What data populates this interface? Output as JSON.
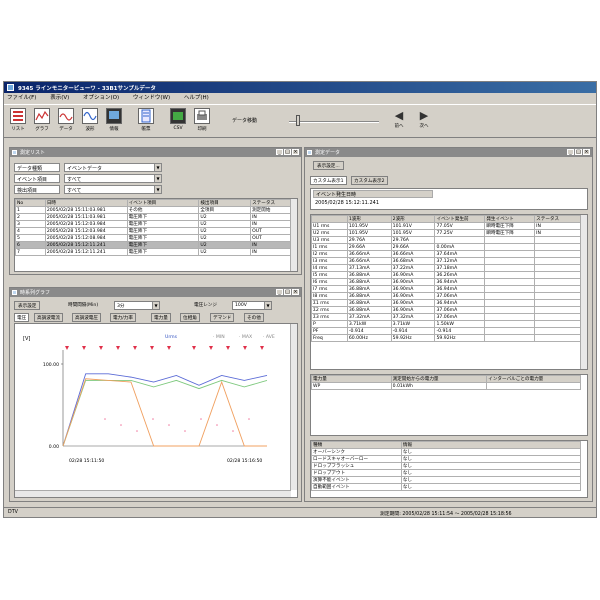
{
  "window": {
    "title": "9345 ラインモニタービューワ - 33B1サンプルデータ"
  },
  "menu": [
    "ファイル(F)",
    "表示(V)",
    "オプション(O)",
    "ウィンドウ(W)",
    "ヘルプ(H)"
  ],
  "toolbar": {
    "buttons": [
      "リスト",
      "グラフ",
      "データ",
      "波形",
      "情報",
      "帳票",
      "CSV",
      "印刷"
    ],
    "slider_label": "データ移動",
    "prev_label": "前へ",
    "next_label": "次へ"
  },
  "event_panel": {
    "title": "測定リスト",
    "filters": [
      {
        "label": "データ種類",
        "value": "イベントデータ"
      },
      {
        "label": "イベント項目",
        "value": "すべて"
      },
      {
        "label": "検出項目",
        "value": "すべて"
      }
    ],
    "columns": [
      "No",
      "日時",
      "イベント項目",
      "検出項目",
      "ステータス"
    ],
    "rows": [
      [
        "1",
        "2005/02/28 15:11:03.981",
        "その他",
        "全項目",
        "測定開始"
      ],
      [
        "2",
        "2005/02/28 15:11:03.981",
        "電圧降下",
        "U2",
        "IN"
      ],
      [
        "3",
        "2005/02/28 15:12:03.984",
        "電圧降下",
        "U2",
        "IN"
      ],
      [
        "4",
        "2005/02/28 15:12:03.984",
        "電圧降下",
        "U2",
        "OUT"
      ],
      [
        "5",
        "2005/02/28 15:12:08.984",
        "電圧降下",
        "U2",
        "OUT"
      ],
      [
        "6",
        "2005/02/28 15:12:11.241",
        "電圧降下",
        "U2",
        "IN"
      ],
      [
        "7",
        "2005/02/28 15:12:11.241",
        "電圧降下",
        "U2",
        "IN"
      ]
    ],
    "selected_row": 5
  },
  "graph_panel": {
    "title": "時系列グラフ",
    "display_settings": "表示設定",
    "interval_label": "時間間隔(Min)",
    "interval_value": "3分",
    "range_label": "電圧レンジ",
    "range_value": "100V",
    "tabs": [
      "電圧",
      "高調波電流",
      "高調波電圧",
      "電力/力率",
      "電力量",
      "位相角",
      "デマンド",
      "その他"
    ],
    "active_tab": 0,
    "legend": [
      "Urms",
      "MIN",
      "MAX",
      "AVE"
    ],
    "unit": "[V]",
    "x_labels": [
      "02/28 15:11:50",
      "02/28 15:16:50"
    ],
    "colors": {
      "blue": "#5b6bd6",
      "green": "#7fc97f",
      "orange": "#f0a060",
      "pink": "#f07aa0",
      "marker": "#e0304a"
    }
  },
  "chart_data": {
    "type": "line",
    "ylabel": "[V]",
    "ylim": [
      0,
      100
    ],
    "y_ticks": [
      "100.00",
      "0.00"
    ],
    "x": [
      0,
      1,
      2,
      3,
      4,
      5,
      6,
      7,
      8,
      9
    ],
    "series": [
      {
        "name": "MAX",
        "color": "#5b6bd6",
        "values": [
          0,
          88,
          88,
          84,
          78,
          86,
          74,
          86,
          80,
          86
        ]
      },
      {
        "name": "AVE",
        "color": "#7fc97f",
        "values": [
          0,
          80,
          80,
          80,
          72,
          80,
          70,
          80,
          72,
          80
        ]
      },
      {
        "name": "MIN",
        "color": "#f0a060",
        "values": [
          0,
          82,
          80,
          78,
          0,
          0,
          0,
          78,
          0,
          0
        ]
      }
    ],
    "grid": false,
    "legend": "top-right"
  },
  "measure_panel": {
    "title": "測定データ",
    "display_settings": "表示設定...",
    "tabs": [
      "カスタム表示1",
      "カスタム表示2"
    ],
    "event_time_label": "イベント発生日時",
    "event_time": "2005/02/28 15:12:11.241",
    "columns": [
      "",
      "1波形",
      "2波形",
      "イベント発生前",
      "発生イベント",
      "ステータス"
    ],
    "rows": [
      [
        "U1 rms",
        "101.95V",
        "101.91V",
        "77.05V",
        "瞬時電圧下降",
        "IN"
      ],
      [
        "U2 rms",
        "101.95V",
        "101.95V",
        "77.25V",
        "瞬時電圧下降",
        "IN"
      ],
      [
        "U3 rms",
        "29.76A",
        "29.76A",
        "",
        "",
        ""
      ],
      [
        "I1 rms",
        "29.66A",
        "29.66A",
        "0.00mA",
        "",
        ""
      ],
      [
        "I2 rms",
        "36.66mA",
        "36.66mA",
        "37.64mA",
        "",
        ""
      ],
      [
        "I3 rms",
        "36.66mA",
        "36.68mA",
        "37.12mA",
        "",
        ""
      ],
      [
        "I4 rms",
        "37.13mA",
        "37.22mA",
        "37.18mA",
        "",
        ""
      ],
      [
        "I5 rms",
        "36.88mA",
        "36.90mA",
        "36.26mA",
        "",
        ""
      ],
      [
        "I6 rms",
        "36.88mA",
        "36.90mA",
        "36.94mA",
        "",
        ""
      ],
      [
        "I7 rms",
        "36.88mA",
        "36.90mA",
        "36.94mA",
        "",
        ""
      ],
      [
        "I8 rms",
        "36.88mA",
        "36.90mA",
        "37.06mA",
        "",
        ""
      ],
      [
        "Σ1 rms",
        "36.88mA",
        "36.90mA",
        "36.94mA",
        "",
        ""
      ],
      [
        "Σ2 rms",
        "36.88mA",
        "36.90mA",
        "37.06mA",
        "",
        ""
      ],
      [
        "Σ3 rms",
        "37.32mA",
        "37.32mA",
        "37.06mA",
        "",
        ""
      ],
      [
        "P",
        "3.71kW",
        "3.71kW",
        "1.50kW",
        "",
        ""
      ],
      [
        "PF",
        "-0.914",
        "-0.914",
        "-0.914",
        "",
        ""
      ],
      [
        "Freq",
        "60.00Hz",
        "59.92Hz",
        "59.92Hz",
        "",
        ""
      ]
    ],
    "power_columns": [
      "電力量",
      "測定開始からの電力量",
      "インターバルごとの電力量"
    ],
    "power_rows": [
      [
        "WP",
        "0.01kWh",
        ""
      ]
    ],
    "info_columns": [
      "種類",
      "情報"
    ],
    "info_rows": [
      [
        "オーバーシンク",
        "なし"
      ],
      [
        "ロードスキャオーバーロー",
        "なし"
      ],
      [
        "ドロップフラッシュ",
        "なし"
      ],
      [
        "ドロップアウト",
        "なし"
      ],
      [
        "演算不能イベント",
        "なし"
      ],
      [
        "自動範囲イベント",
        "なし"
      ]
    ]
  },
  "status": {
    "left": "DTV",
    "right": "測定期間: 2005/02/28 15:11:54 ～ 2005/02/28 15:18:56"
  }
}
